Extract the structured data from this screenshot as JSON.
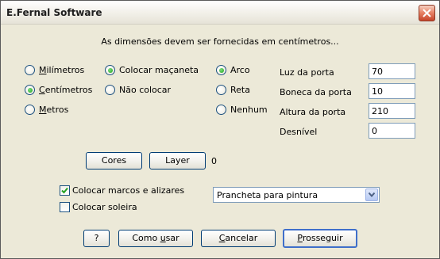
{
  "window": {
    "title": "E.Fernal Software"
  },
  "info_text": "As dimensões devem ser fornecidas em centímetros...",
  "units": [
    {
      "label": "Milímetros",
      "mnemonic": "M",
      "rest": "ilímetros",
      "selected": false
    },
    {
      "label": "Centímetros",
      "mnemonic": "C",
      "rest": "entímetros",
      "selected": true
    },
    {
      "label": "Metros",
      "mnemonic": "M",
      "rest": "etros",
      "selected": false
    }
  ],
  "handle": [
    {
      "label": "Colocar maçaneta",
      "selected": true
    },
    {
      "label": "Não colocar",
      "selected": false
    }
  ],
  "top_shape": [
    {
      "label": "Arco",
      "selected": true
    },
    {
      "label": "Reta",
      "selected": false
    },
    {
      "label": "Nenhum",
      "selected": false
    }
  ],
  "fields": [
    {
      "label": "Luz da porta",
      "value": "70"
    },
    {
      "label": "Boneca da porta",
      "value": "10"
    },
    {
      "label": "Altura da porta",
      "value": "210"
    },
    {
      "label": "Desnível",
      "value": "0"
    }
  ],
  "buttons": {
    "cores": "Cores",
    "layer": "Layer",
    "layer_value": "0",
    "help": "?",
    "how_to_use": {
      "label": "Como usar",
      "pre": "Como ",
      "mnemonic": "u",
      "post": "sar"
    },
    "cancel": {
      "label": "Cancelar",
      "mnemonic": "C",
      "post": "ancelar"
    },
    "proceed": {
      "label": "Prosseguir",
      "mnemonic": "P",
      "post": "rosseguir"
    }
  },
  "checkboxes": [
    {
      "label": "Colocar marcos e alizares",
      "checked": true
    },
    {
      "label": "Colocar soleira",
      "checked": false
    }
  ],
  "layer_select": {
    "selected": "Prancheta para pintura"
  },
  "colors": {
    "accent": "#3f6fca",
    "radio_dot": "#21a121",
    "check": "#21a121",
    "border": "#7f9db9"
  }
}
